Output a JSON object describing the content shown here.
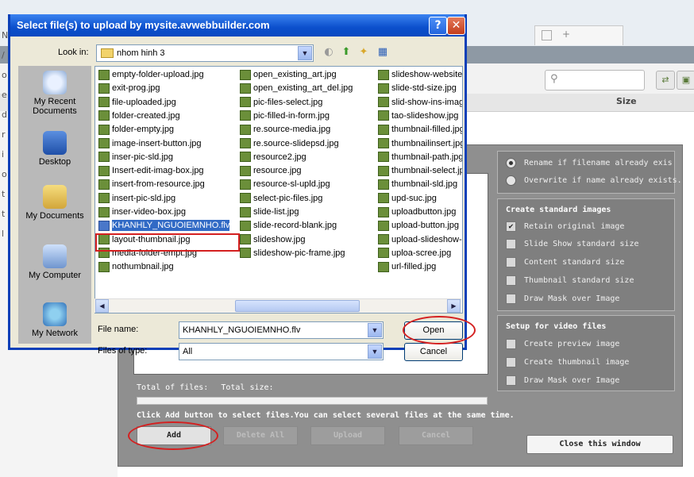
{
  "background_page": {
    "left_letters": [
      "N",
      "/",
      "o",
      "e",
      "d",
      "r",
      "i",
      "o",
      "t",
      "t",
      "l"
    ],
    "size_column": "Size",
    "tab_icon": "+",
    "search_icon": "search-icon",
    "toolbar_icons": [
      "refresh-icon",
      "folder-icon"
    ]
  },
  "dialog": {
    "title": "Select file(s) to upload by mysite.avwebbuilder.com",
    "help_glyph": "?",
    "close_glyph": "✕",
    "look_in_label": "Look in:",
    "look_in_value": "nhom hinh 3",
    "places": [
      "My Recent Documents",
      "Desktop",
      "My Documents",
      "My Computer",
      "My Network"
    ],
    "files_col1": [
      "empty-folder-upload.jpg",
      "exit-prog.jpg",
      "file-uploaded.jpg",
      "folder-created.jpg",
      "folder-empty.jpg",
      "image-insert-button.jpg",
      "inser-pic-sld.jpg",
      "Insert-edit-imag-box.jpg",
      "insert-from-resource.jpg",
      "insert-pic-sld.jpg",
      "inser-video-box.jpg",
      "KHANHLY_NGUOIEMNHO.flv",
      "layout-thumbnail.jpg",
      "media-folder-empt.jpg",
      "nothumbnail.jpg"
    ],
    "files_col2": [
      "open_existing_art.jpg",
      "open_existing_art_del.jpg",
      "pic-files-select.jpg",
      "pic-filled-in-form.jpg",
      "re.source-media.jpg",
      "re.source-slidepsd.jpg",
      "resource2.jpg",
      "resource.jpg",
      "resource-sl-upld.jpg",
      "select-pic-files.jpg",
      "slide-list.jpg",
      "slide-record-blank.jpg",
      "slideshow.jpg",
      "slideshow-pic-frame.jpg"
    ],
    "files_col3": [
      "slideshow-website.",
      "slide-std-size.jpg",
      "slid-show-ins-image",
      "tao-slideshow.jpg",
      "thumbnail-filled.jpg",
      "thumbnailinsert.jpg",
      "thumbnail-path.jpg",
      "thumbnail-select.jp",
      "thumbnail-sld.jpg",
      "upd-suc.jpg",
      "uploadbutton.jpg",
      "upload-button.jpg",
      "upload-slideshow-b",
      "uploa-scree.jpg",
      "url-filled.jpg"
    ],
    "selected_file": "KHANHLY_NGUOIEMNHO.flv",
    "file_name_label": "File name:",
    "file_name_value": "KHANHLY_NGUOIEMNHO.flv",
    "file_type_label": "Files of type:",
    "file_type_value": "All",
    "open_label": "Open",
    "cancel_label": "Cancel"
  },
  "upload_panel": {
    "total_files_label": "Total of files:",
    "total_size_label": "Total size:",
    "hint": "Click Add button to select files.You can select several files at the same time.",
    "buttons": {
      "add": "Add",
      "delete_all": "Delete All",
      "upload": "Upload",
      "cancel": "Cancel"
    },
    "rename_options": [
      {
        "label": "Rename if filename already exis",
        "selected": true
      },
      {
        "label": "Overwrite if name already exists.",
        "selected": false
      }
    ],
    "standard_images": {
      "title": "Create standard images",
      "items": [
        {
          "label": "Retain original image",
          "checked": true
        },
        {
          "label": "Slide Show standard size",
          "checked": false
        },
        {
          "label": "Content standard size",
          "checked": false
        },
        {
          "label": "Thumbnail standard size",
          "checked": false
        },
        {
          "label": "Draw Mask over Image",
          "checked": false
        }
      ]
    },
    "video_files": {
      "title": "Setup for video files",
      "items": [
        {
          "label": "Create preview image",
          "checked": false
        },
        {
          "label": "Create thumbnail image",
          "checked": false
        },
        {
          "label": "Draw Mask over Image",
          "checked": false
        }
      ]
    },
    "close_window": "Close this window"
  }
}
